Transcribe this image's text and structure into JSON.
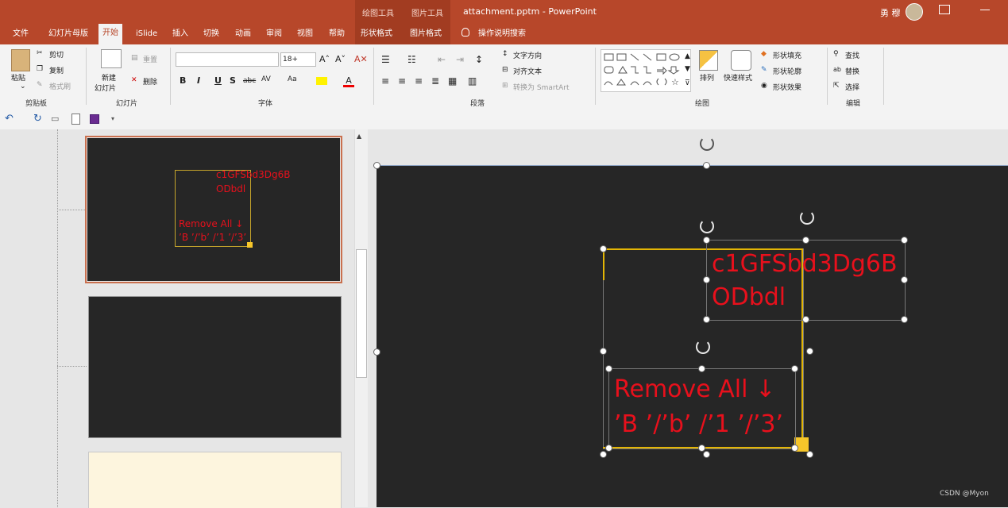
{
  "window": {
    "context_groups": [
      "绘图工具",
      "图片工具"
    ],
    "doc_title": "attachment.pptm  -  PowerPoint",
    "user": "勇 穆"
  },
  "tabs": [
    "文件",
    "幻灯片母版",
    "开始",
    "iSlide",
    "插入",
    "切换",
    "动画",
    "审阅",
    "视图",
    "帮助",
    "形状格式",
    "图片格式"
  ],
  "active_tab": "开始",
  "tell_me": "操作说明搜索",
  "ribbon": {
    "clipboard": {
      "paste": "粘贴",
      "cut": "剪切",
      "copy": "复制",
      "format_painter": "格式刷",
      "label": "剪贴板"
    },
    "slides": {
      "new_slide": "新建",
      "new_slide2": "幻灯片",
      "reset": "重置",
      "delete": "删除",
      "label": "幻灯片"
    },
    "font": {
      "font_name": "",
      "font_size": "18+",
      "bold": "B",
      "italic": "I",
      "underline": "U",
      "shadow": "S",
      "strike": "abc",
      "spacing": "AV",
      "case": "Aa",
      "label": "字体"
    },
    "paragraph": {
      "text_direction": "文字方向",
      "align_text": "对齐文本",
      "smartart": "转换为 SmartArt",
      "label": "段落"
    },
    "drawing": {
      "arrange": "排列",
      "quick_styles": "快速样式",
      "shape_fill": "形状填充",
      "shape_outline": "形状轮廓",
      "shape_effects": "形状效果",
      "label": "绘图"
    },
    "editing": {
      "find": "查找",
      "replace": "替换",
      "select": "选择",
      "label": "编辑"
    }
  },
  "slide_content": {
    "thumb_text1": "c1GFSbd3Dg6B",
    "thumb_text2": "ODbdl",
    "thumb_text3": "Remove All ↓",
    "thumb_text4": "’B ’/’b’ /’1 ’/’3’",
    "text1": "c1GFSbd3Dg6B",
    "text2": "ODbdl",
    "text3": "Remove All ↓",
    "text4": "’B ’/’b’ /’1 ’/’3’"
  },
  "watermark": "CSDN @Myon⁠",
  "colors": {
    "brand": "#b7472a",
    "slide_bg": "#262626",
    "text_red": "#e8101c",
    "selection": "#e3b505"
  }
}
